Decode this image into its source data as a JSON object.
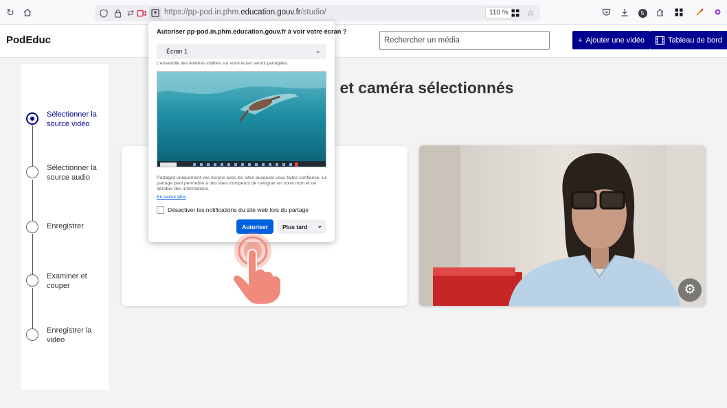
{
  "browser": {
    "url_prefix": "https://pp-pod.in.phm.",
    "url_domain": "education.gouv.fr",
    "url_suffix": "/studio/",
    "zoom": "110 %",
    "notification_badge": "5"
  },
  "header": {
    "logo": "PodEduc",
    "search_placeholder": "Rechercher un média",
    "add_video_label": "Ajouter une vidéo",
    "add_video_icon": "+",
    "dashboard_label": "Tableau de bord"
  },
  "steps": [
    {
      "label": "Sélectionner la source vidéo",
      "active": true
    },
    {
      "label": "Sélectionner la source audio",
      "active": false
    },
    {
      "label": "Enregistrer",
      "active": false
    },
    {
      "label": "Examiner et couper",
      "active": false
    },
    {
      "label": "Enregistrer la vidéo",
      "active": false
    }
  ],
  "main": {
    "title_visible": "n et caméra sélectionnés"
  },
  "popup": {
    "title": "Autoriser pp-pod.in.phm.education.gouv.fr à voir votre écran ?",
    "screen_option": "Écran 1",
    "note": "L'ensemble des fenêtres visibles sur votre écran seront partagées.",
    "warning": "Partagez uniquement vos écrans avec les sites auxquels vous faites confiance. Le partage peut permettre à des sites trompeurs de naviguer en votre nom et de dérober des informations.",
    "learn_more": "En savoir plus",
    "checkbox_label": "Désactiver les notifications du site web lors du partage",
    "allow_label": "Autoriser",
    "later_label": "Plus tard"
  },
  "colors": {
    "primary": "#000091",
    "firefox_blue": "#0061e0"
  }
}
